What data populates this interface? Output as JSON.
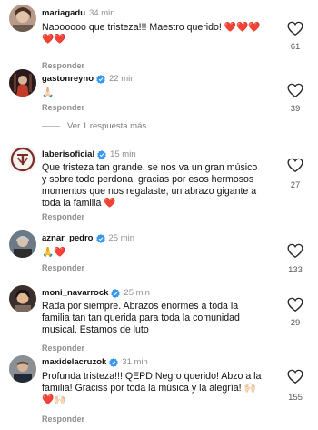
{
  "comments": [
    {
      "username": "mariagadu",
      "time": "34 min",
      "text": "Naoooooo que tristeza!!! Maestro querido! ❤️❤️❤️❤️❤️",
      "reply_label": "Responder",
      "likes": "61",
      "verified": false
    },
    {
      "username": "gastonreyno",
      "time": "22 min",
      "text": "🙏🏻",
      "reply_label": "Responder",
      "likes": "39",
      "verified": true
    },
    {
      "username": "laberisoficial",
      "time": "15 min",
      "text": "Que tristeza tan grande, se nos va un gran músico y sobre todo perdona. gracias por esos hermosos momentos que nos regalaste, un abrazo gigante a toda la familia ❤️",
      "reply_label": "Responder",
      "likes": "27",
      "verified": true
    },
    {
      "username": "aznar_pedro",
      "time": "25 min",
      "text": "🙏❤️",
      "reply_label": "Responder",
      "likes": "133",
      "verified": true
    },
    {
      "username": "moni_navarrock",
      "time": "25 min",
      "text": "Rada por siempre. Abrazos enormes a toda la familia tan tan querida para toda la comunidad musical. Estamos de luto",
      "reply_label": "Responder",
      "likes": "29",
      "verified": true
    },
    {
      "username": "maxidelacruzok",
      "time": "31 min",
      "text": "Profunda tristeza!!! QEPD Negro querido! Abzo a la familia! Graciss por toda la música y la alegría! 🙌🏻❤️🙌🏻",
      "reply_label": "Responder",
      "likes": "155",
      "verified": true
    }
  ],
  "view_replies": "Ver 1 respuesta más",
  "icons": {
    "like": "heart-outline-icon",
    "verified": "verified-badge-icon"
  },
  "colors": {
    "verified": "#3897f0",
    "meta": "#8e8e8e",
    "heart": "#e0243a"
  }
}
